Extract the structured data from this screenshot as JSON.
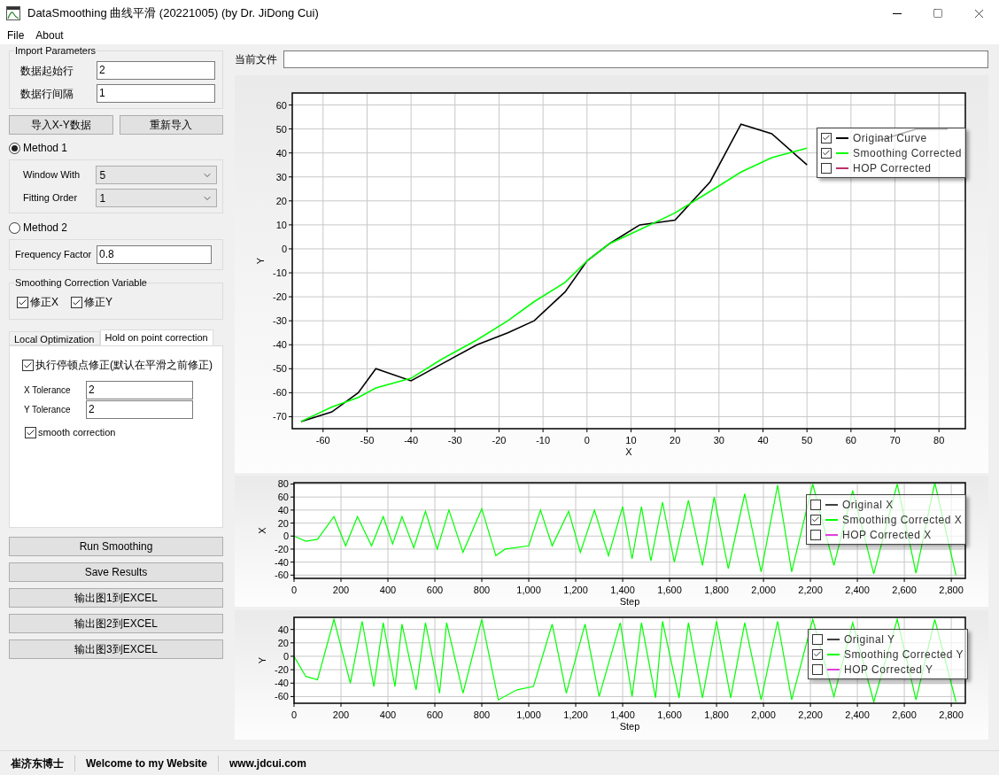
{
  "window": {
    "title": "DataSmoothing 曲线平滑 (20221005) (by Dr. JiDong Cui)"
  },
  "menu": [
    "File",
    "About"
  ],
  "import_parameters": {
    "title": "Import Parameters",
    "fields": [
      {
        "label": "数据起始行",
        "value": "2"
      },
      {
        "label": "数据行间隔",
        "value": "1"
      }
    ]
  },
  "import_buttons": [
    "导入X-Y数据",
    "重新导入"
  ],
  "methods": [
    {
      "label": "Method 1",
      "selected": true,
      "fields": [
        {
          "label": "Window With",
          "value": "5",
          "kind": "dropdown"
        },
        {
          "label": "Fitting Order",
          "value": "1",
          "kind": "dropdown"
        }
      ]
    },
    {
      "label": "Method 2",
      "selected": false,
      "fields": [
        {
          "label": "Frequency Factor",
          "value": "0.8",
          "kind": "text"
        }
      ]
    }
  ],
  "correction_variable": {
    "title": "Smoothing Correction Variable",
    "options": [
      {
        "label": "修正X",
        "checked": true
      },
      {
        "label": "修正Y",
        "checked": true
      }
    ]
  },
  "tabs": [
    {
      "label": "Local Optimization",
      "selected": false
    },
    {
      "label": "Hold on point correction",
      "selected": true
    }
  ],
  "hold_on_point": {
    "enable": {
      "label": "执行停顿点修正(默认在平滑之前修正)",
      "checked": true
    },
    "fields": [
      {
        "label": "X Tolerance",
        "value": "2"
      },
      {
        "label": "Y Tolerance",
        "value": "2"
      }
    ],
    "smooth": {
      "label": "smooth correction",
      "checked": true
    }
  },
  "actions": [
    "Run Smoothing",
    "Save Results",
    "输出图1到EXCEL",
    "输出图2到EXCEL",
    "输出图3到EXCEL"
  ],
  "file": {
    "label": "当前文件"
  },
  "charts": [
    {
      "chart_data": {
        "type": "line",
        "xlabel": "X",
        "ylabel": "Y",
        "xlim": [
          -67,
          86
        ],
        "ylim": [
          -75,
          65
        ],
        "grid": true,
        "legend": {
          "entries": [
            {
              "kind": "series",
              "checked": true
            },
            {
              "kind": "series",
              "checked": true
            },
            {
              "kind": "hidden",
              "label": "HOP Corrected",
              "color": "#c0306a",
              "checked": false
            }
          ]
        },
        "xticks": [
          -60,
          -50,
          -40,
          -30,
          -20,
          -10,
          0,
          10,
          20,
          30,
          40,
          50,
          60,
          70,
          80
        ],
        "yticks": [
          -70,
          -60,
          -50,
          -40,
          -30,
          -20,
          -10,
          0,
          10,
          20,
          30,
          40,
          50,
          60
        ],
        "x": [
          -65,
          -58,
          -52,
          -48,
          -40,
          -33,
          -25,
          -18,
          -12,
          -5,
          0,
          5,
          12,
          20,
          28,
          35,
          42,
          50,
          58,
          66,
          75,
          82
        ],
        "series": [
          {
            "name": "Original Curve",
            "color": "#000000",
            "values": [
              -72,
              -68,
              -60,
              -50,
              -55,
              -48,
              -40,
              -35,
              -30,
              -18,
              -5,
              2,
              10,
              12,
              28,
              52,
              48,
              35,
              null,
              45,
              50,
              50
            ]
          },
          {
            "name": "Smoothing Corrected",
            "color": "#00ff00",
            "values": [
              -72,
              -66,
              -62,
              -58,
              -54,
              -46,
              -38,
              -30,
              -22,
              -14,
              -5,
              2,
              8,
              15,
              24,
              32,
              38,
              42,
              null,
              null,
              null,
              null
            ]
          }
        ]
      }
    },
    {
      "chart_data": {
        "type": "line",
        "xlabel": "Step",
        "ylabel": "X",
        "xlim": [
          0,
          2860
        ],
        "ylim": [
          -65,
          82
        ],
        "grid": true,
        "legend": {
          "entries": [
            {
              "kind": "hidden",
              "label": "Original X",
              "color": "#404040",
              "checked": false
            },
            {
              "kind": "series",
              "checked": true
            },
            {
              "kind": "hidden",
              "label": "HOP Corrected X",
              "color": "#e040e0",
              "checked": false
            }
          ]
        },
        "xticks": [
          0,
          200,
          400,
          600,
          800,
          {
            "value": 1000,
            "label": "1,000"
          },
          {
            "value": 1200,
            "label": "1,200"
          },
          {
            "value": 1400,
            "label": "1,400"
          },
          {
            "value": 1600,
            "label": "1,600"
          },
          {
            "value": 1800,
            "label": "1,800"
          },
          {
            "value": 2000,
            "label": "2,000"
          },
          {
            "value": 2200,
            "label": "2,200"
          },
          {
            "value": 2400,
            "label": "2,400"
          },
          {
            "value": 2600,
            "label": "2,600"
          },
          {
            "value": 2800,
            "label": "2,800"
          }
        ],
        "yticks": [
          -60,
          -40,
          -20,
          0,
          20,
          40,
          60,
          80
        ],
        "x": [
          0,
          50,
          100,
          170,
          220,
          270,
          330,
          380,
          420,
          460,
          510,
          560,
          610,
          660,
          720,
          800,
          860,
          900,
          1000,
          1050,
          1100,
          1170,
          1220,
          1280,
          1340,
          1400,
          1440,
          1480,
          1520,
          1570,
          1620,
          1680,
          1740,
          1790,
          1850,
          1920,
          1990,
          2060,
          2120,
          2210,
          2300,
          2380,
          2470,
          2570,
          2650,
          2730,
          2820
        ],
        "series": [
          {
            "name": "Smoothing Corrected X",
            "color": "#00ff00",
            "values": [
              0,
              -8,
              -5,
              30,
              -15,
              30,
              -15,
              30,
              -12,
              30,
              -18,
              38,
              -20,
              40,
              -25,
              42,
              -30,
              -20,
              -15,
              40,
              -15,
              38,
              -25,
              40,
              -30,
              45,
              -35,
              45,
              -38,
              52,
              -40,
              55,
              -45,
              60,
              -50,
              65,
              -55,
              78,
              -55,
              80,
              -45,
              70,
              -58,
              80,
              -57,
              82,
              -60
            ]
          }
        ]
      }
    },
    {
      "chart_data": {
        "type": "line",
        "xlabel": "Step",
        "ylabel": "Y",
        "xlim": [
          0,
          2860
        ],
        "ylim": [
          -70,
          58
        ],
        "grid": true,
        "legend": {
          "entries": [
            {
              "kind": "hidden",
              "label": "Original Y",
              "color": "#404040",
              "checked": false
            },
            {
              "kind": "series",
              "checked": true
            },
            {
              "kind": "hidden",
              "label": "HOP Corrected Y",
              "color": "#e040e0",
              "checked": false
            }
          ]
        },
        "xticks": [
          0,
          200,
          400,
          600,
          800,
          {
            "value": 1000,
            "label": "1,000"
          },
          {
            "value": 1200,
            "label": "1,200"
          },
          {
            "value": 1400,
            "label": "1,400"
          },
          {
            "value": 1600,
            "label": "1,600"
          },
          {
            "value": 1800,
            "label": "1,800"
          },
          {
            "value": 2000,
            "label": "2,000"
          },
          {
            "value": 2200,
            "label": "2,200"
          },
          {
            "value": 2400,
            "label": "2,400"
          },
          {
            "value": 2600,
            "label": "2,600"
          },
          {
            "value": 2800,
            "label": "2,800"
          }
        ],
        "yticks": [
          -60,
          -40,
          -20,
          0,
          20,
          40
        ],
        "x": [
          0,
          50,
          100,
          170,
          240,
          290,
          340,
          380,
          430,
          460,
          520,
          560,
          620,
          650,
          720,
          800,
          870,
          950,
          1020,
          1100,
          1160,
          1240,
          1300,
          1390,
          1440,
          1480,
          1540,
          1570,
          1640,
          1680,
          1740,
          1800,
          1860,
          1920,
          1990,
          2060,
          2120,
          2210,
          2300,
          2380,
          2470,
          2570,
          2650,
          2730,
          2820
        ],
        "series": [
          {
            "name": "Smoothing Corrected Y",
            "color": "#00ff00",
            "values": [
              0,
              -30,
              -35,
              55,
              -40,
              52,
              -45,
              50,
              -45,
              48,
              -50,
              50,
              -55,
              50,
              -55,
              55,
              -65,
              -50,
              -45,
              48,
              -55,
              48,
              -60,
              50,
              -60,
              50,
              -62,
              52,
              -62,
              50,
              -62,
              52,
              -62,
              50,
              -65,
              52,
              -65,
              55,
              -60,
              50,
              -68,
              55,
              -65,
              55,
              -68
            ]
          }
        ]
      }
    }
  ],
  "status_bar": [
    "崔济东博士",
    "Welcome to my Website",
    "www.jdcui.com"
  ]
}
